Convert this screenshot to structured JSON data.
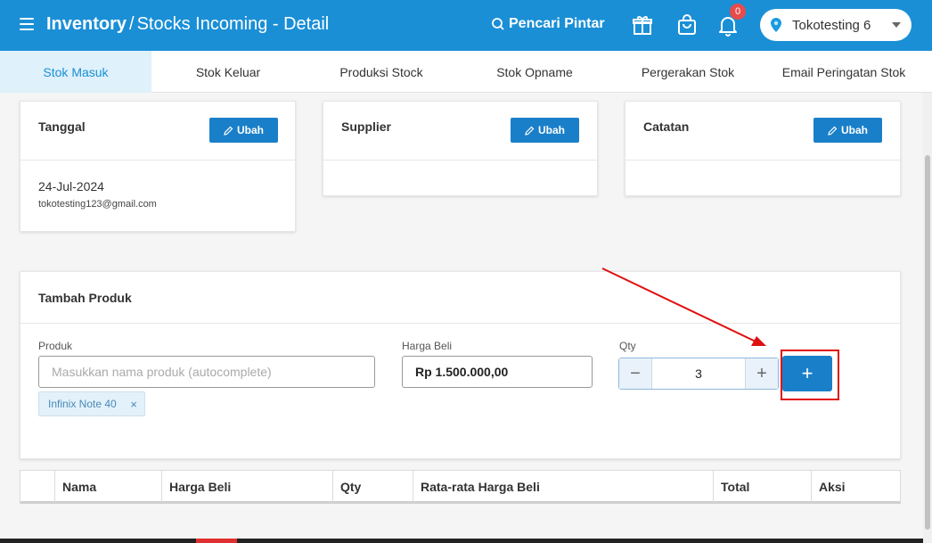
{
  "header": {
    "title_bold": "Inventory",
    "title_sep": "/",
    "title_rest": "Stocks Incoming - Detail",
    "smart_search": "Pencari Pintar",
    "notif_count": "0",
    "store_name": "Tokotesting 6"
  },
  "tabs": [
    {
      "label": "Stok Masuk",
      "active": true
    },
    {
      "label": "Stok Keluar"
    },
    {
      "label": "Produksi Stock"
    },
    {
      "label": "Stok Opname"
    },
    {
      "label": "Pergerakan Stok"
    },
    {
      "label": "Email Peringatan Stok"
    }
  ],
  "cards": {
    "tanggal": {
      "title": "Tanggal",
      "button": "Ubah",
      "date": "24-Jul-2024",
      "email": "tokotesting123@gmail.com"
    },
    "supplier": {
      "title": "Supplier",
      "button": "Ubah"
    },
    "catatan": {
      "title": "Catatan",
      "button": "Ubah"
    }
  },
  "add_product": {
    "title": "Tambah Produk",
    "product_label": "Produk",
    "product_placeholder": "Masukkan nama produk (autocomplete)",
    "product_chip": "Infinix Note 40",
    "chip_remove": "×",
    "price_label": "Harga Beli",
    "price_value": "Rp 1.500.000,00",
    "qty_label": "Qty",
    "qty_value": "3",
    "minus": "−",
    "plus": "+",
    "add": "+"
  },
  "table": {
    "columns": [
      "",
      "Nama",
      "Harga Beli",
      "Qty",
      "Rata-rata Harga Beli",
      "Total",
      "Aksi"
    ]
  },
  "colors": {
    "primary": "#1a8fd6",
    "button": "#1a7fc9",
    "highlight": "#e01010"
  }
}
